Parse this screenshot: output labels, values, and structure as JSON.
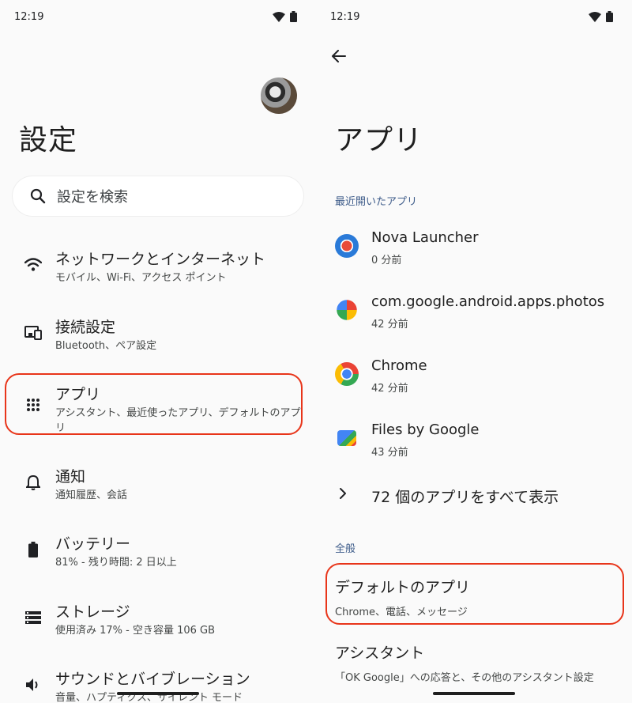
{
  "left": {
    "status": {
      "time": "12:19"
    },
    "title": "設定",
    "search": {
      "placeholder": "設定を検索",
      "icon": "search-icon"
    },
    "items": [
      {
        "title": "ネットワークとインターネット",
        "subtitle": "モバイル、Wi-Fi、アクセス ポイント",
        "icon": "wifi-icon"
      },
      {
        "title": "接続設定",
        "subtitle": "Bluetooth、ペア設定",
        "icon": "connected-devices-icon"
      },
      {
        "title": "アプリ",
        "subtitle": "アシスタント、最近使ったアプリ、デフォルトのアプリ",
        "icon": "apps-grid-icon"
      },
      {
        "title": "通知",
        "subtitle": "通知履歴、会話",
        "icon": "bell-icon"
      },
      {
        "title": "バッテリー",
        "subtitle": "81% - 残り時間: 2 日以上",
        "icon": "battery-icon"
      },
      {
        "title": "ストレージ",
        "subtitle": "使用済み 17% - 空き容量 106 GB",
        "icon": "storage-icon"
      },
      {
        "title": "サウンドとバイブレーション",
        "subtitle": "音量、ハプティクス、サイレント モード",
        "icon": "volume-icon"
      }
    ]
  },
  "right": {
    "status": {
      "time": "12:19"
    },
    "title": "アプリ",
    "recent_label": "最近開いたアプリ",
    "apps": [
      {
        "name": "Nova Launcher",
        "time": "0 分前",
        "icon": "nova-launcher-icon"
      },
      {
        "name": "com.google.android.apps.photos",
        "time": "42 分前",
        "icon": "photos-icon"
      },
      {
        "name": "Chrome",
        "time": "42 分前",
        "icon": "chrome-icon"
      },
      {
        "name": "Files by Google",
        "time": "43 分前",
        "icon": "files-icon"
      }
    ],
    "show_all": "72 個のアプリをすべて表示",
    "general_label": "全般",
    "default_apps": {
      "title": "デフォルトのアプリ",
      "subtitle": "Chrome、電話、メッセージ"
    },
    "assistant": {
      "title": "アシスタント",
      "subtitle": "「OK Google」への応答と、その他のアシスタント設定"
    }
  },
  "colors": {
    "highlight": "#e8351a",
    "section_label": "#3e5c8a",
    "background": "#fafafa"
  }
}
